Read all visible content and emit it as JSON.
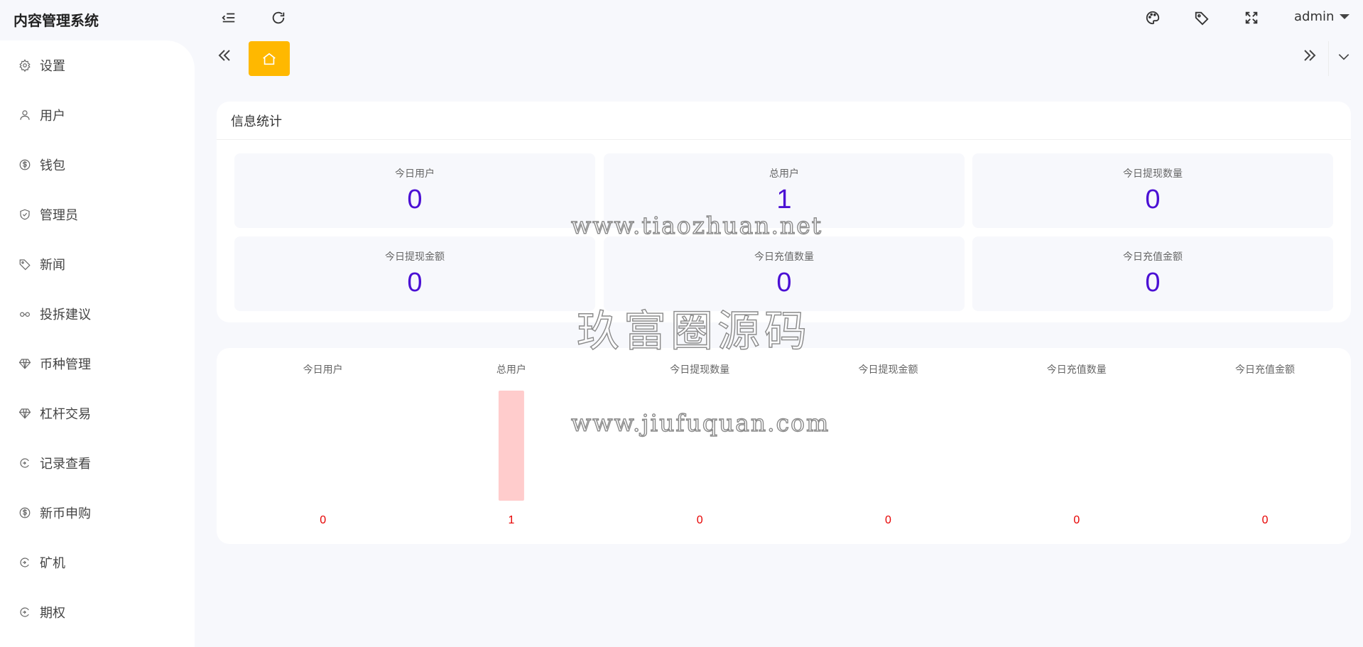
{
  "app": {
    "title": "内容管理系统"
  },
  "header": {
    "user": "admin",
    "icons": [
      "collapse-menu-icon",
      "refresh-icon",
      "theme-palette-icon",
      "tag-icon",
      "fullscreen-icon"
    ]
  },
  "sidebar": {
    "items": [
      {
        "label": "设置",
        "icon": "gear-icon"
      },
      {
        "label": "用户",
        "icon": "user-icon"
      },
      {
        "label": "钱包",
        "icon": "dollar-circle-icon"
      },
      {
        "label": "管理员",
        "icon": "shield-check-icon"
      },
      {
        "label": "新闻",
        "icon": "tag-icon"
      },
      {
        "label": "投拆建议",
        "icon": "link-icon"
      },
      {
        "label": "币种管理",
        "icon": "diamond-icon"
      },
      {
        "label": "杠杆交易",
        "icon": "diamond-icon"
      },
      {
        "label": "记录查看",
        "icon": "circle-arrow-icon"
      },
      {
        "label": "新币申购",
        "icon": "dollar-circle-icon"
      },
      {
        "label": "矿机",
        "icon": "circle-arrow-icon"
      },
      {
        "label": "期权",
        "icon": "circle-arrow-icon"
      }
    ]
  },
  "tabs": {
    "home_icon": "home-icon"
  },
  "stats": {
    "title": "信息统计",
    "tiles": [
      {
        "label": "今日用户",
        "value": "0"
      },
      {
        "label": "总用户",
        "value": "1"
      },
      {
        "label": "今日提现数量",
        "value": "0"
      },
      {
        "label": "今日提现金额",
        "value": "0"
      },
      {
        "label": "今日充值数量",
        "value": "0"
      },
      {
        "label": "今日充值金额",
        "value": "0"
      }
    ]
  },
  "chart_data": {
    "type": "bar",
    "categories": [
      "今日用户",
      "总用户",
      "今日提现数量",
      "今日提现金额",
      "今日充值数量",
      "今日充值金额"
    ],
    "values": [
      0,
      1,
      0,
      0,
      0,
      0
    ],
    "bar_color": "#ffcccc",
    "label_color": "#e60000",
    "ylim": [
      0,
      1
    ]
  },
  "watermarks": [
    "www.tiaozhuan.net",
    "玖富圈源码",
    "www.jiufuquan.com"
  ],
  "colors": {
    "accent": "#ffb800",
    "stat_value": "#4b10d4"
  }
}
